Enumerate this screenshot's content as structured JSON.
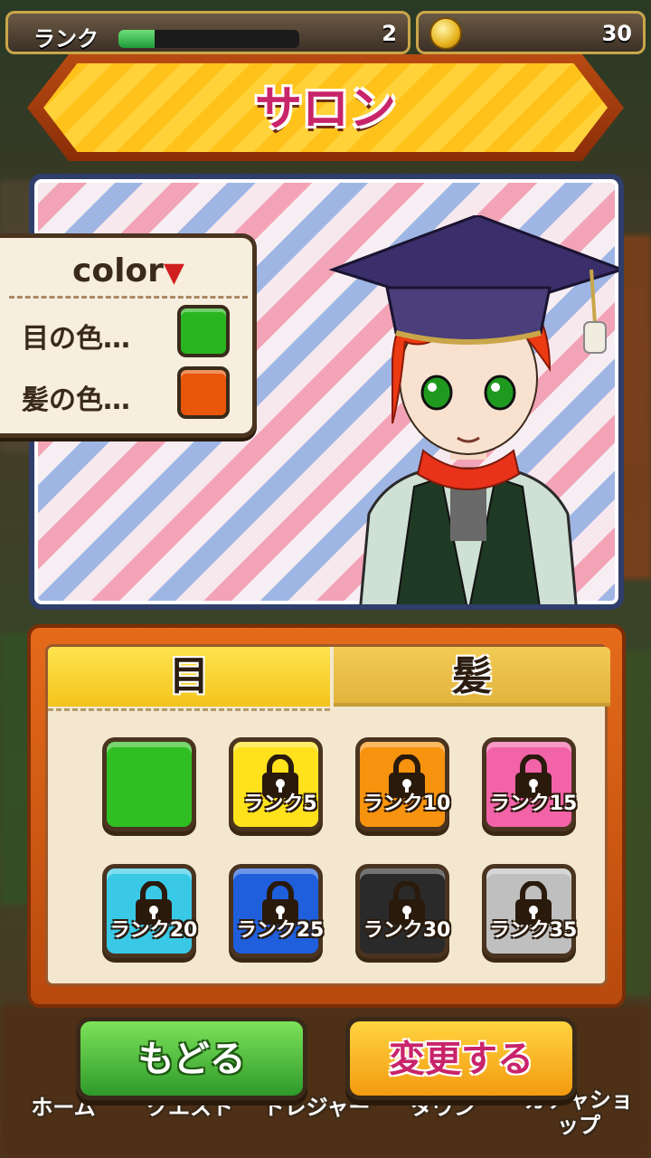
{
  "status": {
    "rank_label": "ランク",
    "rank_value": "2",
    "rank_progress": 0.2,
    "coins": "30"
  },
  "title": "サロン",
  "color_popup": {
    "title": "color",
    "arrow": "▼",
    "eye_label": "目の色…",
    "hair_label": "髪の色…",
    "eye_color": "#29b51f",
    "hair_color": "#e8560a"
  },
  "tabs": {
    "eye": "目",
    "hair": "髪",
    "active": "eye"
  },
  "eye_options": [
    {
      "color": "#2fbf22",
      "locked": false,
      "rank": ""
    },
    {
      "color": "#ffe21c",
      "locked": true,
      "rank": "ランク5"
    },
    {
      "color": "#f7930f",
      "locked": true,
      "rank": "ランク10"
    },
    {
      "color": "#f263a8",
      "locked": true,
      "rank": "ランク15"
    },
    {
      "color": "#39c9e6",
      "locked": true,
      "rank": "ランク20"
    },
    {
      "color": "#1f5fdc",
      "locked": true,
      "rank": "ランク25"
    },
    {
      "color": "#2a2a2a",
      "locked": true,
      "rank": "ランク30"
    },
    {
      "color": "#bfbfbf",
      "locked": true,
      "rank": "ランク35"
    }
  ],
  "buttons": {
    "back": "もどる",
    "change": "変更する"
  },
  "nav": [
    "ホーム",
    "クエスト",
    "トレジャー",
    "タウン",
    "ガチャショップ"
  ]
}
